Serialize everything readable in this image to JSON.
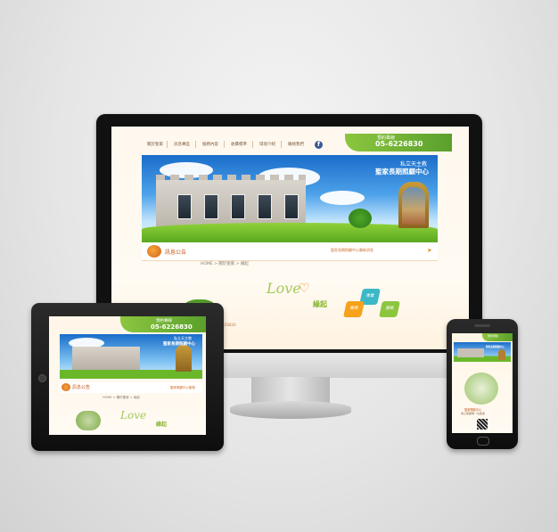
{
  "monitor": {
    "nav": [
      "關於聖家",
      "訊息專區",
      "服務內容",
      "收費標準",
      "環境介紹",
      "聯絡我們"
    ],
    "fb_icon": "f",
    "phone_label": "預約專線",
    "phone_number": "05-6226830",
    "banner_line1": "私立天主教",
    "banner_line2": "聖家長期照顧中心",
    "news_title": "訊息公告",
    "news_link": "聖家長期照顧中心最新消息",
    "news_more": "➤",
    "breadcrumb": "HOME > 關於聖家 > 緣起",
    "love_text": "Love",
    "heart": "♡",
    "yuanqi": "緣起",
    "tiles": [
      "專業",
      "關懷",
      "服務"
    ],
    "footer_text": "私立天主教聖家長期照顧中心 05-6226830"
  },
  "tablet": {
    "phone_label": "預約專線",
    "phone_number": "05-6226830",
    "banner_line1": "私立天主教",
    "banner_line2": "聖家長期照顧中心",
    "news_title": "訊息公告",
    "news_link": "聖家照顧中心動態",
    "breadcrumb": "HOME > 關於聖家 > 緣起",
    "love_text": "Love",
    "yuanqi": "緣起"
  },
  "phone": {
    "phone_label": "預約專線",
    "banner_line2": "聖家長期照顧中心",
    "caption1": "聖家照顧中心",
    "caption2": "用心照顧每一位長輩",
    "qr_label": "QR"
  },
  "colors": {
    "accent_green": "#8cc63f",
    "accent_orange": "#e3942f",
    "banner_blue": "#1a6dc9"
  }
}
